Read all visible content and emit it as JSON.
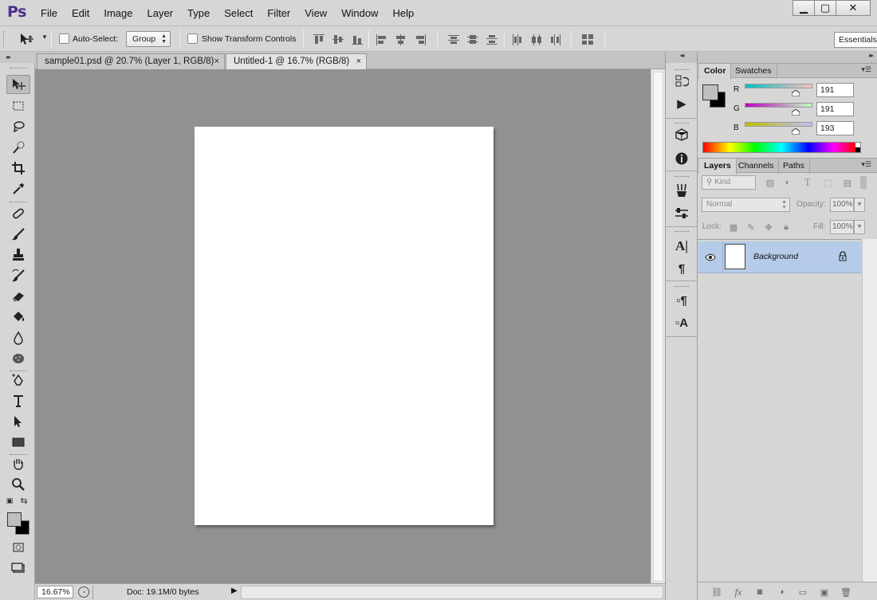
{
  "app": {
    "logo": "Ps"
  },
  "menu": {
    "items": [
      "File",
      "Edit",
      "Image",
      "Layer",
      "Type",
      "Select",
      "Filter",
      "View",
      "Window",
      "Help"
    ]
  },
  "window_controls": {
    "minimize": "▁",
    "maximize": "▢",
    "close": "✕"
  },
  "options_bar": {
    "auto_select_label": "Auto-Select:",
    "auto_select_checked": false,
    "auto_select_target": "Group",
    "show_transform_label": "Show Transform Controls",
    "show_transform_checked": false,
    "workspace": "Essentials"
  },
  "tabs": [
    {
      "label": "sample01.psd @ 20.7% (Layer 1, RGB/8)",
      "active": false,
      "close": "×"
    },
    {
      "label": "Untitled-1 @ 16.7% (RGB/8)",
      "active": true,
      "close": "×"
    }
  ],
  "status": {
    "zoom": "16.67%",
    "doc": "Doc: 19.1M/0 bytes",
    "arrow": "▶"
  },
  "color_panel": {
    "tabs": [
      "Color",
      "Swatches"
    ],
    "active_tab": "Color",
    "channels": [
      {
        "label": "R",
        "value": "191",
        "gradient": [
          "#00c0c1",
          "#ffc0c1"
        ],
        "fraction": 0.749
      },
      {
        "label": "G",
        "value": "191",
        "gradient": [
          "#bf00c1",
          "#bfffc1"
        ],
        "fraction": 0.749
      },
      {
        "label": "B",
        "value": "193",
        "gradient": [
          "#bfbf00",
          "#bfbfff"
        ],
        "fraction": 0.757
      }
    ],
    "foreground": "#bfbfc1",
    "background": "#000000"
  },
  "layers_panel": {
    "tabs": [
      "Layers",
      "Channels",
      "Paths"
    ],
    "active_tab": "Layers",
    "filter_kind": "Kind",
    "blend_mode": "Normal",
    "opacity_label": "Opacity:",
    "opacity": "100%",
    "lock_label": "Lock:",
    "fill_label": "Fill:",
    "fill": "100%",
    "layers": [
      {
        "name": "Background",
        "visible": true,
        "locked": true,
        "selected": true
      }
    ]
  }
}
